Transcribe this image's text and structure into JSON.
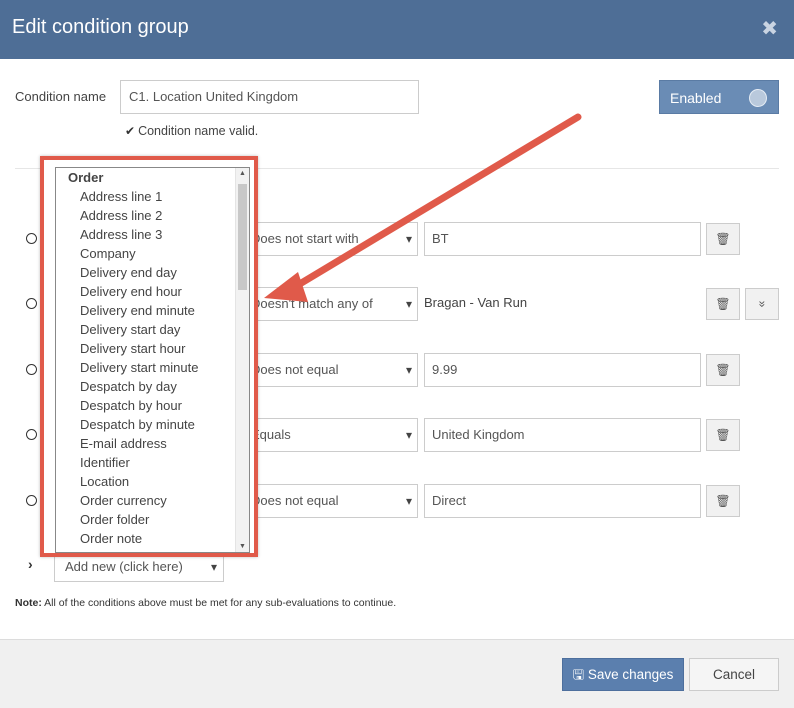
{
  "dialog": {
    "title": "Edit condition group",
    "close_glyph": "✖"
  },
  "condition": {
    "name_label": "Condition name",
    "name_value": "C1. Location United Kingdom",
    "valid_message": "Condition name valid.",
    "enabled_label": "Enabled"
  },
  "rows": [
    {
      "operator": "Does not start with",
      "value": "BT",
      "value_is_input": true,
      "has_expand": false
    },
    {
      "operator": "Doesn't match any of",
      "value": "Bragan - Van Run",
      "value_is_input": false,
      "has_expand": true
    },
    {
      "operator": "Does not equal",
      "value": "9.99",
      "value_is_input": true,
      "has_expand": false
    },
    {
      "operator": "Equals",
      "value": "United Kingdom",
      "value_is_input": true,
      "has_expand": false
    },
    {
      "operator": "Does not equal",
      "value": "Direct",
      "value_is_input": true,
      "has_expand": false
    }
  ],
  "dropdown": {
    "group": "Order",
    "items": [
      "Address line 1",
      "Address line 2",
      "Address line 3",
      "Company",
      "Delivery end day",
      "Delivery end hour",
      "Delivery end minute",
      "Delivery start day",
      "Delivery start hour",
      "Delivery start minute",
      "Despatch by day",
      "Despatch by hour",
      "Despatch by minute",
      "E-mail address",
      "Identifier",
      "Location",
      "Order currency",
      "Order folder",
      "Order note"
    ]
  },
  "add_new_label": "Add new (click here)",
  "note": {
    "prefix": "Note:",
    "text": " All of the conditions above must be met for any sub-evaluations to continue."
  },
  "footer": {
    "save_label": "Save changes",
    "cancel_label": "Cancel"
  },
  "colors": {
    "header": "#4e6e96",
    "highlight": "#e05a4a",
    "primary": "#5b7fae"
  }
}
